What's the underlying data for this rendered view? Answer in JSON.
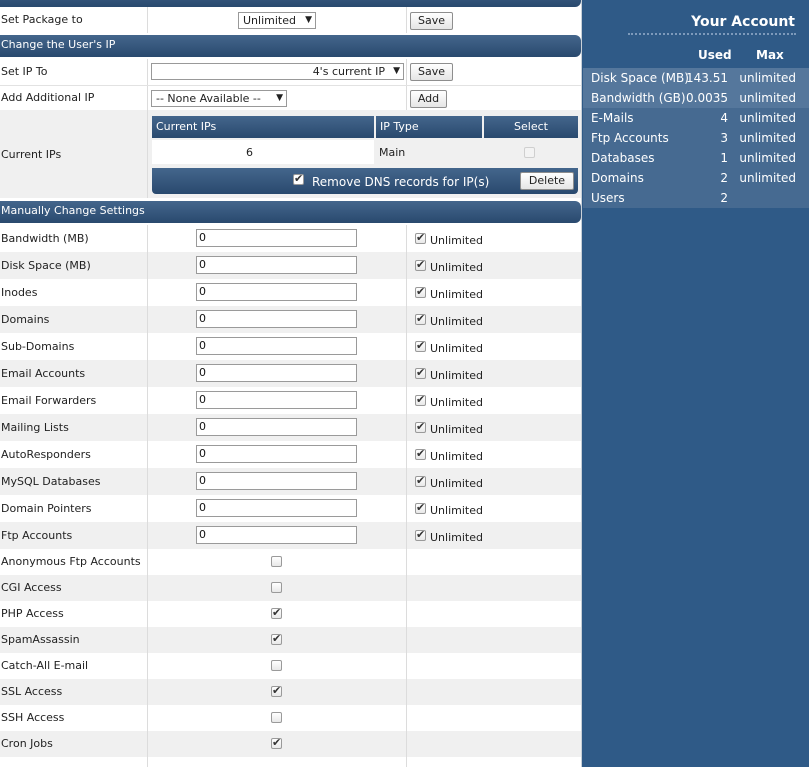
{
  "package": {
    "label": "Set Package to",
    "selected": "Unlimited",
    "save_label": "Save"
  },
  "ip_section": {
    "title": "Change the User's IP",
    "set_ip_label": "Set IP To",
    "set_ip_selected": "4's current IP",
    "save_label": "Save",
    "add_ip_label": "Add Additional IP",
    "add_ip_selected": "-- None Available --",
    "add_label": "Add",
    "current_ips_label": "Current IPs",
    "table_headers": [
      "Current IPs",
      "IP Type",
      "Select"
    ],
    "rows": [
      {
        "ip": "6",
        "type": "Main",
        "selected": false
      }
    ],
    "remove_dns_label": "Remove DNS records for IP(s)",
    "remove_dns_checked": true,
    "delete_label": "Delete"
  },
  "settings": {
    "title": "Manually Change Settings",
    "unlimited_label": "Unlimited",
    "limits": [
      {
        "label": "Bandwidth (MB)",
        "value": "0",
        "unlimited": true
      },
      {
        "label": "Disk Space (MB)",
        "value": "0",
        "unlimited": true
      },
      {
        "label": "Inodes",
        "value": "0",
        "unlimited": true
      },
      {
        "label": "Domains",
        "value": "0",
        "unlimited": true
      },
      {
        "label": "Sub-Domains",
        "value": "0",
        "unlimited": true
      },
      {
        "label": "Email Accounts",
        "value": "0",
        "unlimited": true
      },
      {
        "label": "Email Forwarders",
        "value": "0",
        "unlimited": true
      },
      {
        "label": "Mailing Lists",
        "value": "0",
        "unlimited": true
      },
      {
        "label": "AutoResponders",
        "value": "0",
        "unlimited": true
      },
      {
        "label": "MySQL Databases",
        "value": "0",
        "unlimited": true
      },
      {
        "label": "Domain Pointers",
        "value": "0",
        "unlimited": true
      },
      {
        "label": "Ftp Accounts",
        "value": "0",
        "unlimited": true
      }
    ],
    "toggles": [
      {
        "label": "Anonymous Ftp Accounts",
        "checked": false
      },
      {
        "label": "CGI Access",
        "checked": false
      },
      {
        "label": "PHP Access",
        "checked": true
      },
      {
        "label": "SpamAssassin",
        "checked": true
      },
      {
        "label": "Catch-All E-mail",
        "checked": false
      },
      {
        "label": "SSL Access",
        "checked": true
      },
      {
        "label": "SSH Access",
        "checked": false
      },
      {
        "label": "Cron Jobs",
        "checked": true
      }
    ]
  },
  "account": {
    "title": "Your Account",
    "col_used": "Used",
    "col_max": "Max",
    "rows": [
      {
        "label": "Disk Space (MB)",
        "used": "143.51",
        "max": "unlimited"
      },
      {
        "label": "Bandwidth (GB)",
        "used": "0.0035",
        "max": "unlimited"
      },
      {
        "label": "E-Mails",
        "used": "4",
        "max": "unlimited"
      },
      {
        "label": "Ftp Accounts",
        "used": "3",
        "max": "unlimited"
      },
      {
        "label": "Databases",
        "used": "1",
        "max": "unlimited"
      },
      {
        "label": "Domains",
        "used": "2",
        "max": "unlimited"
      },
      {
        "label": "Users",
        "used": "2",
        "max": ""
      }
    ]
  },
  "colors": {
    "header_bar": "#2f5280",
    "sidebar_bg": "#2f5a87"
  }
}
